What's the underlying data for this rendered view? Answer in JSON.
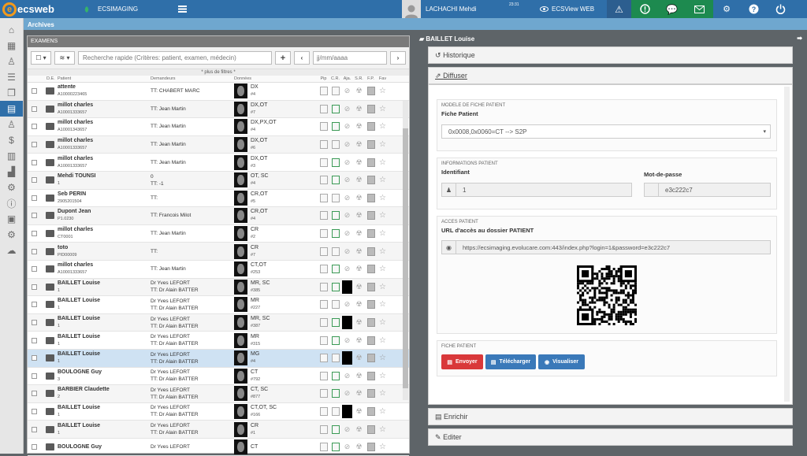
{
  "topbar": {
    "logo_text": "ecsweb",
    "site_name": "ECSIMAGING",
    "user_name": "LACHACHI Mehdi",
    "time": "23:31",
    "viewer_label": "ECSView WEB"
  },
  "breadcrumb": "Archives",
  "left_panel": {
    "title": "EXAMENS",
    "search_placeholder": "Recherche rapide (Critères: patient, examen, médecin)",
    "date_placeholder": "jj/mm/aaaa",
    "more_filters": "* plus de filtres *",
    "columns": [
      "D.E.",
      "Patient",
      "Demandeurs",
      "Données",
      "Pip",
      "C.R.",
      "Aja.",
      "S.R.",
      "F.P.",
      "Fav"
    ],
    "rows": [
      {
        "patient": "attente",
        "pid": "A10000223465",
        "dem1": "",
        "dem2": "TT: CHABERT MARC",
        "modality": "DX",
        "series": "#4",
        "sel": false
      },
      {
        "patient": "millot charles",
        "pid": "A10001333657",
        "dem1": "",
        "dem2": "TT: Jean Martin",
        "modality": "DX,OT",
        "series": "#7",
        "sel": false
      },
      {
        "patient": "millot charles",
        "pid": "A10001343657",
        "dem1": "",
        "dem2": "TT: Jean Martin",
        "modality": "DX,PX,OT",
        "series": "#4",
        "sel": false
      },
      {
        "patient": "millot charles",
        "pid": "A10001333657",
        "dem1": "",
        "dem2": "TT: Jean Martin",
        "modality": "DX,OT",
        "series": "#6",
        "sel": false
      },
      {
        "patient": "millot charles",
        "pid": "A10001333657",
        "dem1": "",
        "dem2": "TT: Jean Martin",
        "modality": "DX,OT",
        "series": "#3",
        "sel": false
      },
      {
        "patient": "Mehdi TOUNSI",
        "pid": "1",
        "dem1": "0",
        "dem2": "TT: -1",
        "modality": "OT, SC",
        "series": "#4",
        "sel": false
      },
      {
        "patient": "Seb PERIN",
        "pid": "2905201504",
        "dem1": "",
        "dem2": "TT:",
        "modality": "CR,OT",
        "series": "#5",
        "sel": false
      },
      {
        "patient": "Dupont Jean",
        "pid": "P1.0230",
        "dem1": "",
        "dem2": "TT: Francois Milot",
        "modality": "CR,OT",
        "series": "#4",
        "sel": false
      },
      {
        "patient": "millot charles",
        "pid": "CT0001",
        "dem1": "",
        "dem2": "TT: Jean Martin",
        "modality": "CR",
        "series": "#2",
        "sel": false
      },
      {
        "patient": "toto",
        "pid": "PID00009",
        "dem1": "",
        "dem2": "TT:",
        "modality": "CR",
        "series": "#7",
        "sel": false
      },
      {
        "patient": "millot charles",
        "pid": "A10001333657",
        "dem1": "",
        "dem2": "TT: Jean Martin",
        "modality": "CT,OT",
        "series": "#253",
        "sel": false
      },
      {
        "patient": "BAILLET Louise",
        "pid": "1",
        "dem1": "Dr Yves LEFORT",
        "dem2": "TT: Dr Alain BATTER",
        "modality": "MR, SC",
        "series": "#385",
        "sel": false
      },
      {
        "patient": "BAILLET Louise",
        "pid": "1",
        "dem1": "Dr Yves LEFORT",
        "dem2": "TT: Dr Alain BATTER",
        "modality": "MR",
        "series": "#227",
        "sel": false
      },
      {
        "patient": "BAILLET Louise",
        "pid": "1",
        "dem1": "Dr Yves LEFORT",
        "dem2": "TT: Dr Alain BATTER",
        "modality": "MR, SC",
        "series": "#387",
        "sel": false
      },
      {
        "patient": "BAILLET Louise",
        "pid": "1",
        "dem1": "Dr Yves LEFORT",
        "dem2": "TT: Dr Alain BATTER",
        "modality": "MR",
        "series": "#315",
        "sel": false
      },
      {
        "patient": "BAILLET Louise",
        "pid": "1",
        "dem1": "Dr Yves LEFORT",
        "dem2": "TT: Dr Alain BATTER",
        "modality": "MG",
        "series": "#4",
        "sel": true
      },
      {
        "patient": "BOULOGNE Guy",
        "pid": "3",
        "dem1": "Dr Yves LEFORT",
        "dem2": "TT: Dr Alain BATTER",
        "modality": "CT",
        "series": "#792",
        "sel": false
      },
      {
        "patient": "BARBIER Claudette",
        "pid": "2",
        "dem1": "Dr Yves LEFORT",
        "dem2": "TT: Dr Alain BATTER",
        "modality": "CT, SC",
        "series": "#877",
        "sel": false
      },
      {
        "patient": "BAILLET Louise",
        "pid": "1",
        "dem1": "Dr Yves LEFORT",
        "dem2": "TT: Dr Alain BATTER",
        "modality": "CT,OT, SC",
        "series": "#166",
        "sel": false
      },
      {
        "patient": "BAILLET Louise",
        "pid": "1",
        "dem1": "Dr Yves LEFORT",
        "dem2": "TT: Dr Alain BATTER",
        "modality": "CR",
        "series": "#1",
        "sel": false
      },
      {
        "patient": "BOULOGNE Guy",
        "pid": "",
        "dem1": "Dr Yves LEFORT",
        "dem2": "",
        "modality": "CT",
        "series": "",
        "sel": false
      }
    ]
  },
  "right_panel": {
    "title": "BAILLET Louise",
    "historique": "Historique",
    "diffuser": "Diffuser",
    "enrichir": "Enrichir",
    "editer": "Editer",
    "modele_header": "MODELE DE FICHE PATIENT",
    "fiche_patient_label": "Fiche Patient",
    "fiche_patient_value": "0x0008,0x0060=CT --> S2P",
    "info_header": "INFORMATIONS PATIENT",
    "identifiant_label": "Identifiant",
    "identifiant_value": "1",
    "password_label": "Mot-de-passe",
    "password_value": "e3c222c7",
    "acces_header": "ACCES PATIENT",
    "url_label": "URL d'accès au dossier PATIENT",
    "url_value": "https://ecsimaging.evolucare.com:443/index.php?login=1&password=e3c222c7",
    "fiche_header": "FICHE PATIENT",
    "btn_envoyer": "Envoyer",
    "btn_telecharger": "Télécharger",
    "btn_visualiser": "Visualiser"
  },
  "colors": {
    "topbar": "#2f6fa9",
    "green": "#1d8a4f",
    "red": "#d9383a",
    "blue": "#3a79b9"
  }
}
